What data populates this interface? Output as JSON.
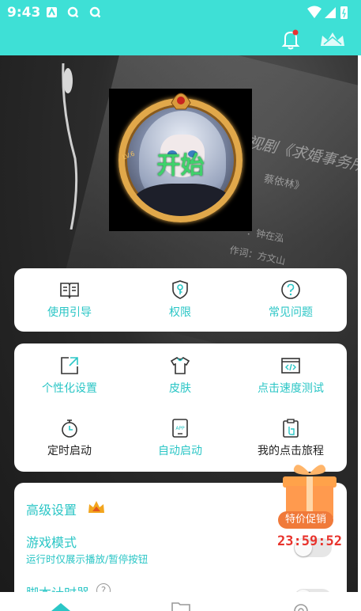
{
  "status_bar": {
    "time": "9:43"
  },
  "header": {
    "notification_icon": "bell-icon",
    "vip_icon": "crown-icon"
  },
  "hero": {
    "background_text": [
      "视剧《求婚事务所》",
      "蔡依林》",
      "：钟在泓",
      "作词：方文山"
    ],
    "start_label": "开始",
    "avatar_tag": "LV.6"
  },
  "quick_links": [
    {
      "label": "使用引导",
      "icon": "book-icon"
    },
    {
      "label": "权限",
      "icon": "shield-key-icon"
    },
    {
      "label": "常见问题",
      "icon": "question-icon"
    }
  ],
  "tools": [
    {
      "label": "个性化设置",
      "icon": "customize-icon",
      "accent": true
    },
    {
      "label": "皮肤",
      "icon": "shirt-icon",
      "accent": true
    },
    {
      "label": "点击速度测试",
      "icon": "code-window-icon",
      "accent": true
    },
    {
      "label": "定时启动",
      "icon": "stopwatch-icon",
      "accent": false
    },
    {
      "label": "自动启动",
      "icon": "app-icon",
      "accent": true
    },
    {
      "label": "我的点击旅程",
      "icon": "clipboard-tap-icon",
      "accent": false
    }
  ],
  "advanced": {
    "title": "高级设置",
    "game_mode_title": "游戏模式",
    "game_mode_desc": "运行时仅展示播放/暂停按钮",
    "game_mode_enabled": false,
    "script_timer_title": "脚本计时器",
    "script_timer_help": "?",
    "script_timer_enabled": false
  },
  "promo": {
    "badge": "特价促销",
    "countdown": "23:59:52"
  },
  "bottom_nav": [
    "home-icon",
    "folder-icon",
    "settings-icon"
  ],
  "colors": {
    "accent": "#2bc6c6",
    "header": "#3ee0d6",
    "promo": "#f07a3a",
    "countdown": "#e8332c"
  }
}
